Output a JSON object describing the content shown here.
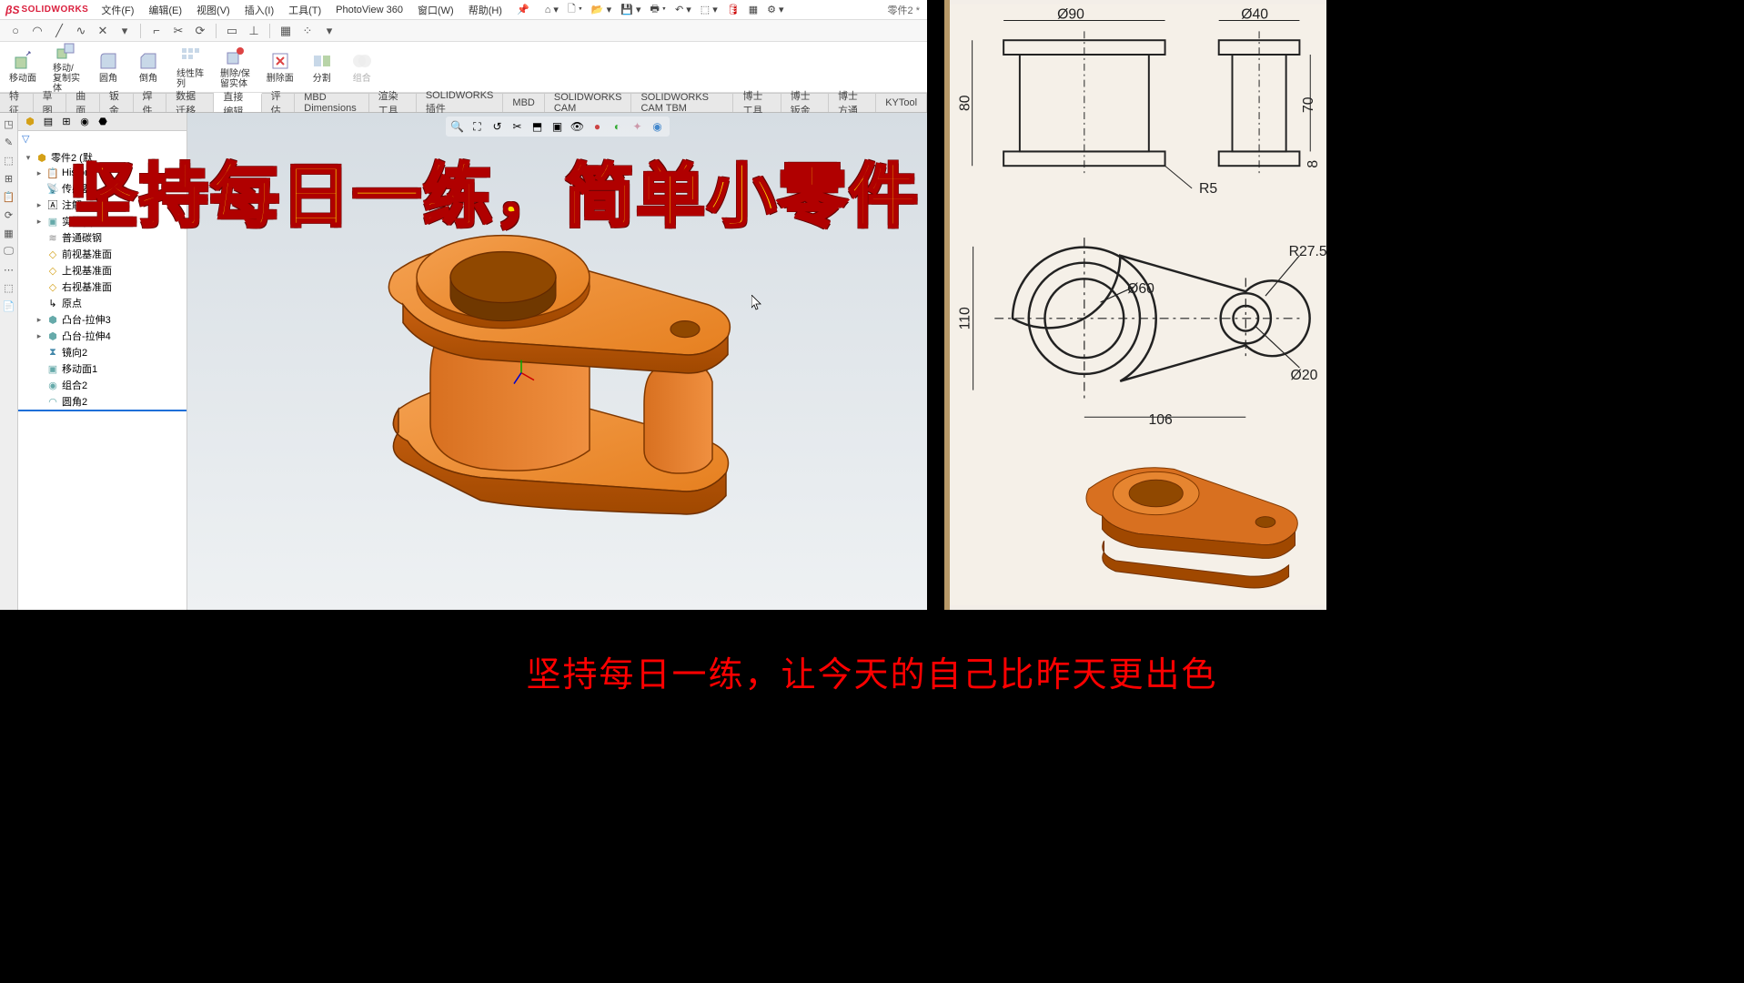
{
  "app": {
    "logo_text": "SOLIDWORKS",
    "doc_title": "零件2 *"
  },
  "menu": {
    "file": "文件(F)",
    "edit": "编辑(E)",
    "view": "视图(V)",
    "insert": "插入(I)",
    "tools": "工具(T)",
    "photoview": "PhotoView 360",
    "window": "窗口(W)",
    "help": "帮助(H)"
  },
  "ribbon": {
    "move_face": "移动面",
    "move_copy_body": "移动/\n复制实\n体",
    "fillet": "圆角",
    "chamfer": "倒角",
    "linear_pattern": "线性阵\n列",
    "delete_keep_body": "删除/保\n留实体",
    "delete_face": "删除面",
    "split": "分割",
    "combine": "组合"
  },
  "tabs": [
    "特征",
    "草图",
    "曲面",
    "钣金",
    "焊件",
    "数据迁移",
    "直接编辑",
    "评估",
    "MBD Dimensions",
    "渲染工具",
    "SOLIDWORKS 插件",
    "MBD",
    "SOLIDWORKS CAM",
    "SOLIDWORKS CAM TBM",
    "博士工具",
    "博士钣金",
    "博士方通",
    "KYTool"
  ],
  "active_tab": "直接编辑",
  "tree": {
    "root": "零件2 (默",
    "history": "Histor",
    "sensors": "传感器",
    "annotations": "注解",
    "solid_bodies": "实体(1)",
    "material": "普通碳钢",
    "front_plane": "前视基准面",
    "top_plane": "上视基准面",
    "right_plane": "右视基准面",
    "origin": "原点",
    "extrude3": "凸台-拉伸3",
    "extrude4": "凸台-拉伸4",
    "mirror2": "镜向2",
    "move_face1": "移动面1",
    "combine2": "组合2",
    "fillet2": "圆角2"
  },
  "drawing": {
    "d90": "Ø90",
    "d40": "Ø40",
    "d80": "80",
    "d70": "70",
    "d8": "8",
    "r5": "R5",
    "d110": "110",
    "d60": "Ø60",
    "r275": "R27.5",
    "d20": "Ø20",
    "d106": "106"
  },
  "overlay": "坚持每日一练，简单小零件",
  "caption": "坚持每日一练，让今天的自己比昨天更出色"
}
